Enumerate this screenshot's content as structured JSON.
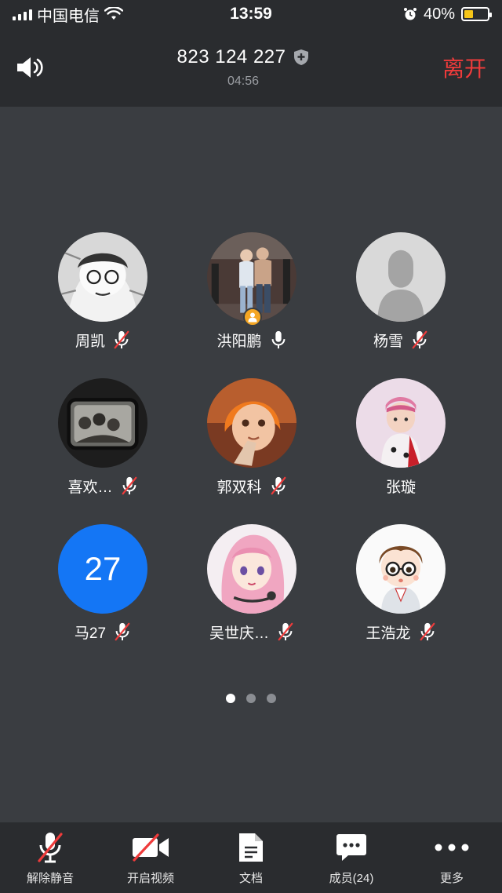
{
  "status": {
    "carrier": "中国电信",
    "time": "13:59",
    "battery": "40%",
    "battery_level": 0.4
  },
  "header": {
    "meeting_id": "823 124 227",
    "duration": "04:56",
    "leave_label": "离开"
  },
  "participants": [
    {
      "name": "周凯",
      "mic": "muted",
      "avatar": "manga"
    },
    {
      "name": "洪阳鹏",
      "mic": "on",
      "avatar": "gym-photo",
      "host": true
    },
    {
      "name": "杨雪",
      "mic": "muted",
      "avatar": "default"
    },
    {
      "name": "喜欢…",
      "mic": "muted",
      "avatar": "train-photo"
    },
    {
      "name": "郭双科",
      "mic": "muted",
      "avatar": "cartoon-girl"
    },
    {
      "name": "张璇",
      "mic": "none",
      "avatar": "girl-photo"
    },
    {
      "name": "马27",
      "mic": "muted",
      "avatar": "number",
      "avatar_text": "27"
    },
    {
      "name": "吴世庆…",
      "mic": "muted",
      "avatar": "anime-girl"
    },
    {
      "name": "王浩龙",
      "mic": "muted",
      "avatar": "cartoon-boy"
    }
  ],
  "pagination": {
    "pages": 3,
    "current": 1
  },
  "toolbar": {
    "unmute_label": "解除静音",
    "video_label": "开启视频",
    "docs_label": "文档",
    "members_label": "成员(24)",
    "more_label": "更多"
  },
  "colors": {
    "background": "#3a3d41",
    "bar": "#2a2c2f",
    "leave": "#ef3b3b",
    "number_avatar": "#1476f5",
    "host_badge": "#f5a623"
  }
}
